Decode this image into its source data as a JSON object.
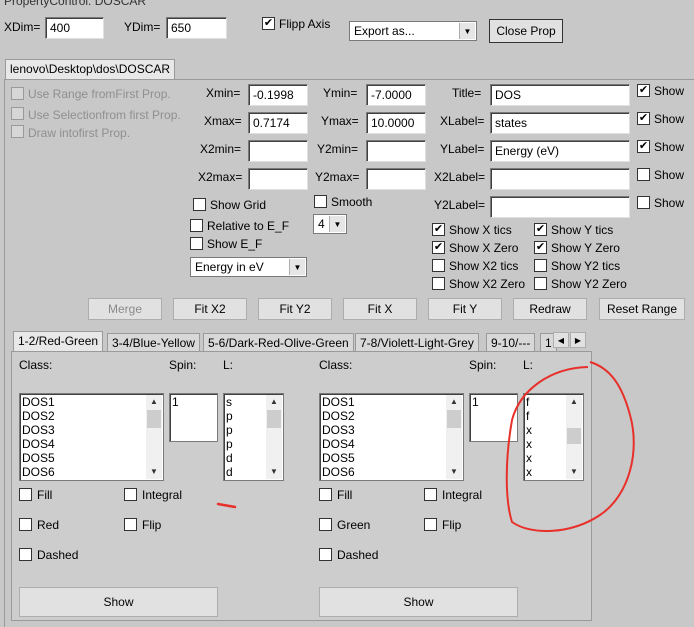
{
  "window": {
    "title": "PropertyControl: DOSCAR"
  },
  "top": {
    "xdim_label": "XDim=",
    "xdim_value": "400",
    "ydim_label": "YDim=",
    "ydim_value": "650",
    "flipp_axis_label": "Flipp Axis",
    "export_value": "Export as...",
    "close_label": "Close Prop"
  },
  "file_tab": "lenovo\\Desktop\\dos\\DOSCAR",
  "left_options": {
    "use_range": "Use Range fromFirst Prop.",
    "use_selection": "Use Selectionfrom first Prop.",
    "draw_into": "Draw intofirst Prop."
  },
  "ranges": {
    "xmin_label": "Xmin=",
    "xmin": "-0.1998",
    "xmax_label": "Xmax=",
    "xmax": "0.7174",
    "x2min_label": "X2min=",
    "x2min": "",
    "x2max_label": "X2max=",
    "x2max": "",
    "ymin_label": "Ymin=",
    "ymin": "-7.0000",
    "ymax_label": "Ymax=",
    "ymax": "10.0000",
    "y2min_label": "Y2min=",
    "y2min": "",
    "y2max_label": "Y2max=",
    "y2max": ""
  },
  "labels": {
    "title_label": "Title=",
    "title": "DOS",
    "xlabel_label": "XLabel=",
    "xlabel": "states",
    "ylabel_label": "YLabel=",
    "ylabel": "Energy (eV)",
    "x2label_label": "X2Label=",
    "x2label": "",
    "y2label_label": "Y2Label=",
    "y2label": "",
    "show": "Show"
  },
  "options": {
    "show_grid": "Show Grid",
    "smooth": "Smooth",
    "relative": "Relative to E_F",
    "smooth_value": "4",
    "show_ef": "Show E_F",
    "energy_unit": "Energy in eV"
  },
  "tics": {
    "show_x_tics": "Show X tics",
    "show_y_tics": "Show Y tics",
    "show_x_zero": "Show X Zero",
    "show_y_zero": "Show Y Zero",
    "show_x2_tics": "Show X2 tics",
    "show_y2_tics": "Show Y2 tics",
    "show_x2_zero": "Show X2 Zero",
    "show_y2_zero": "Show Y2 Zero"
  },
  "buttons": {
    "merge": "Merge",
    "fit_x2": "Fit X2",
    "fit_y2": "Fit Y2",
    "fit_x": "Fit X",
    "fit_y": "Fit Y",
    "redraw": "Redraw",
    "reset_range": "Reset Range"
  },
  "series_tabs": [
    "1-2/Red-Green",
    "3-4/Blue-Yellow",
    "5-6/Dark-Red-Olive-Green",
    "7-8/Violett-Light-Grey",
    "9-10/---",
    "1"
  ],
  "panel_left": {
    "class_label": "Class:",
    "spin_label": "Spin:",
    "l_label": "L:",
    "classes": [
      "DOS1",
      "DOS2",
      "DOS3",
      "DOS4",
      "DOS5",
      "DOS6"
    ],
    "spin": [
      "1"
    ],
    "l": [
      "s",
      "p",
      "p",
      "p",
      "d",
      "d"
    ],
    "fill": "Fill",
    "integral": "Integral",
    "color": "Red",
    "flip": "Flip",
    "dashed": "Dashed",
    "show": "Show"
  },
  "panel_right": {
    "class_label": "Class:",
    "spin_label": "Spin:",
    "l_label": "L:",
    "classes": [
      "DOS1",
      "DOS2",
      "DOS3",
      "DOS4",
      "DOS5",
      "DOS6"
    ],
    "spin": [
      "1"
    ],
    "l": [
      "f",
      "f",
      "x",
      "x",
      "x",
      "x"
    ],
    "fill": "Fill",
    "integral": "Integral",
    "color": "Green",
    "flip": "Flip",
    "dashed": "Dashed",
    "show": "Show"
  }
}
